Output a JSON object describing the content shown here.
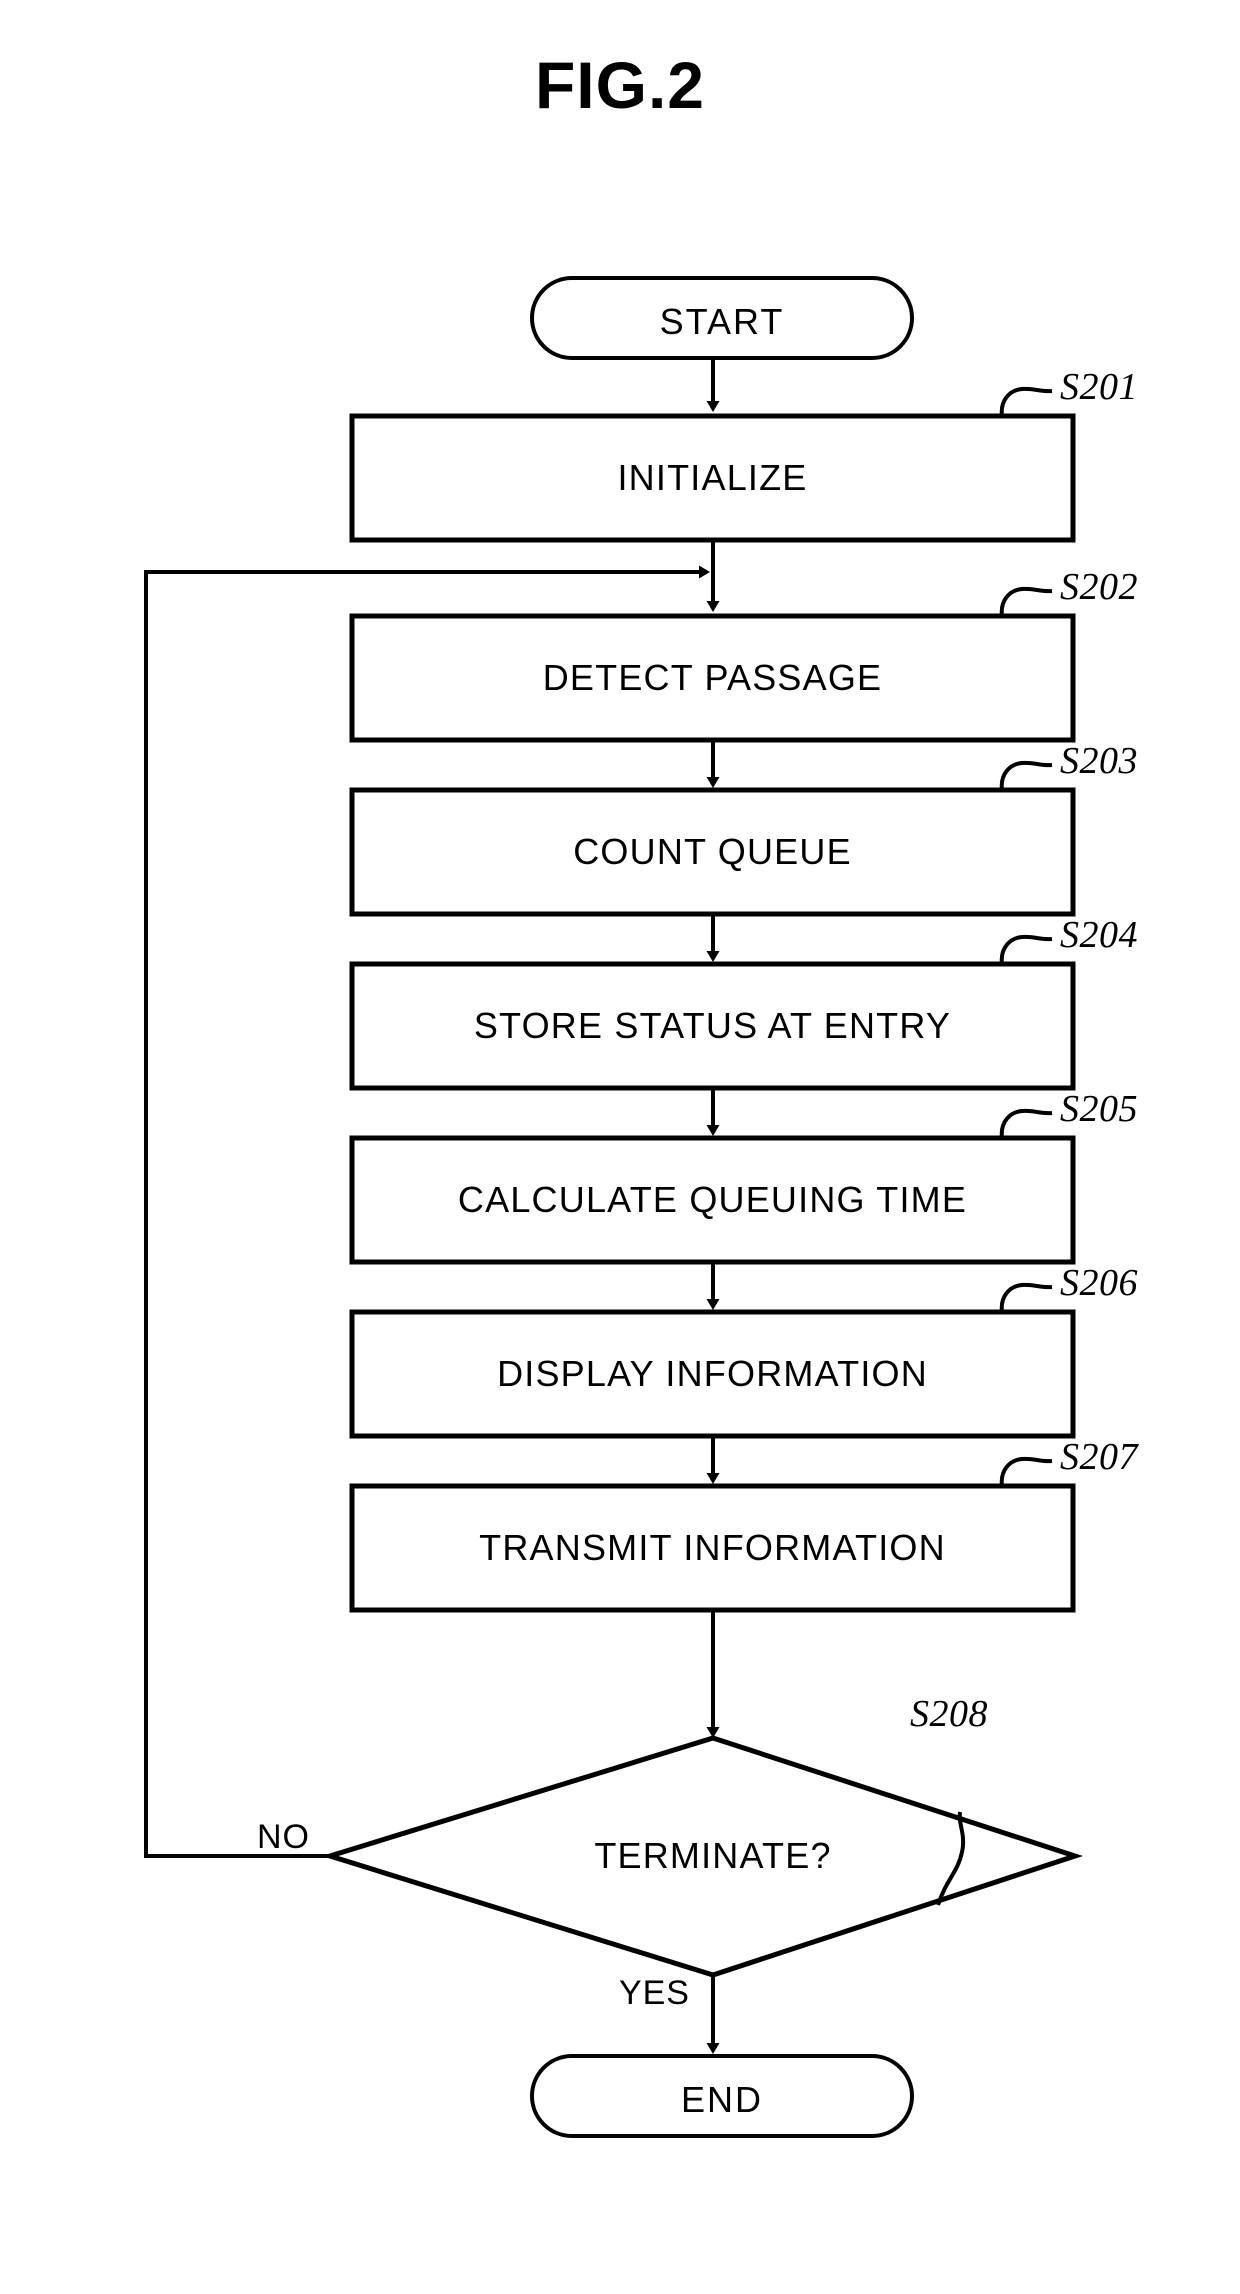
{
  "figure": {
    "title": "FIG.2",
    "type": "flowchart"
  },
  "nodes": {
    "start": {
      "label": "START",
      "shape": "terminal"
    },
    "end": {
      "label": "END",
      "shape": "terminal"
    },
    "s201": {
      "label": "INITIALIZE",
      "ref": "S201",
      "shape": "process"
    },
    "s202": {
      "label": "DETECT PASSAGE",
      "ref": "S202",
      "shape": "process"
    },
    "s203": {
      "label": "COUNT QUEUE",
      "ref": "S203",
      "shape": "process"
    },
    "s204": {
      "label": "STORE STATUS AT ENTRY",
      "ref": "S204",
      "shape": "process"
    },
    "s205": {
      "label": "CALCULATE QUEUING TIME",
      "ref": "S205",
      "shape": "process"
    },
    "s206": {
      "label": "DISPLAY INFORMATION",
      "ref": "S206",
      "shape": "process"
    },
    "s207": {
      "label": "TRANSMIT INFORMATION",
      "ref": "S207",
      "shape": "process"
    },
    "s208": {
      "label": "TERMINATE?",
      "ref": "S208",
      "shape": "decision"
    }
  },
  "branches": {
    "no": "NO",
    "yes": "YES"
  },
  "style": {
    "stroke": "#000000",
    "fill": "#ffffff",
    "background": "#ffffff"
  }
}
